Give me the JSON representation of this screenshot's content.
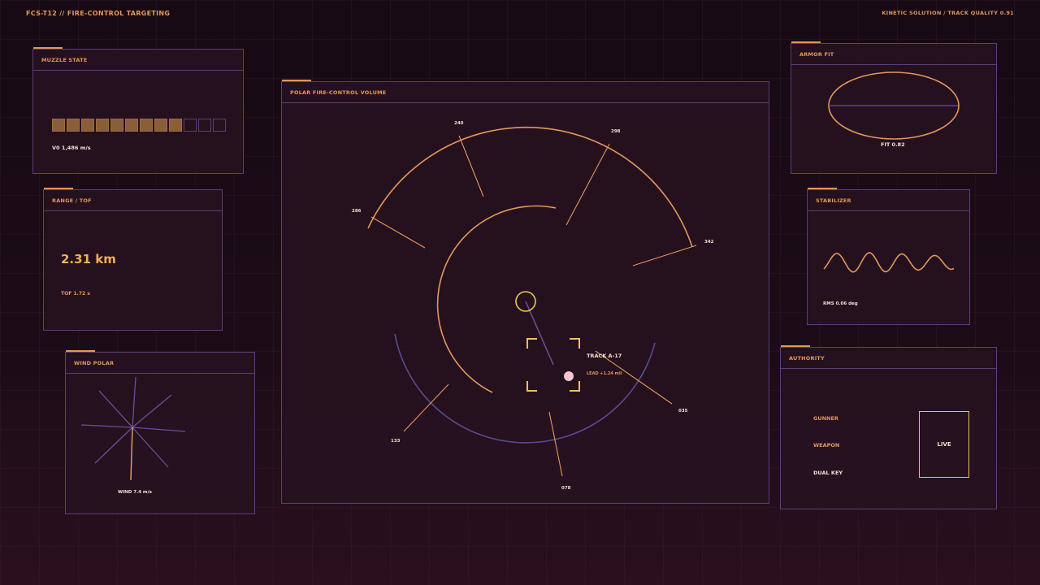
{
  "header": {
    "title": "FCS-T12  //  FIRE-CONTROL TARGETING",
    "status": "KINETIC SOLUTION / TRACK QUALITY 0.91"
  },
  "muzzle": {
    "title": "MUZZLE STATE",
    "segments_total": 12,
    "segments_on": 9,
    "velocity": "V0  1,486 m/s"
  },
  "range": {
    "title": "RANGE / TOF",
    "value": "2.31 km",
    "tof": "TOF 1.72 s"
  },
  "wind": {
    "title": "WIND POLAR",
    "label": "WIND 7.4 m/s"
  },
  "polar": {
    "title": "POLAR FIRE-CONTROL VOLUME",
    "bearings": [
      "240",
      "298",
      "286",
      "342",
      "035",
      "133",
      "078"
    ],
    "track_label": "TRACK A-17",
    "lead_label": "LEAD +1.24 mil"
  },
  "armor": {
    "title": "ARMOR FIT",
    "fit": "FIT  0.82"
  },
  "stabilizer": {
    "title": "STABILIZER",
    "rms": "RMS 0.06 deg"
  },
  "authority": {
    "title": "AUTHORITY",
    "items": [
      "GUNNER",
      "WEAPON",
      "DUAL KEY"
    ],
    "status": "LIVE"
  },
  "colors": {
    "accent": "#e2975a",
    "gold": "#f0b057",
    "border": "#5a3f78",
    "background": "#1c0c17"
  }
}
